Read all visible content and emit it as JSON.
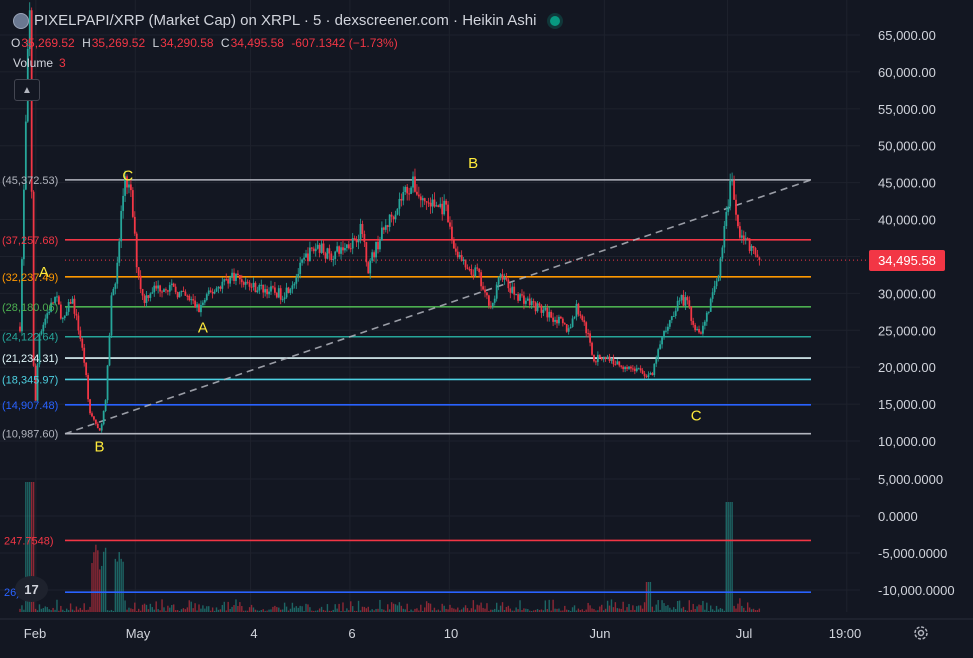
{
  "header": {
    "title": "PIXELPAPI/XRP (Market Cap) on XRPL · 5 · dexscreener.com · Heikin Ashi",
    "ohlc": [
      {
        "k": "O",
        "v": "35,269.52"
      },
      {
        "k": "H",
        "v": "35,269.52"
      },
      {
        "k": "L",
        "v": "34,290.58"
      },
      {
        "k": "C",
        "v": "34,495.58"
      }
    ],
    "change": "-607.1342 (−1.73%)",
    "volume_label": "Volume",
    "volume_value": "3"
  },
  "colors": {
    "bg": "#131722",
    "up": "#26a69a",
    "down": "#f23645",
    "grid": "#1e222d",
    "text": "#d1d4dc",
    "annotation": "#ffeb3b"
  },
  "current_price_label": "34,495.58",
  "icons": {
    "collapse": "chevron-up-icon",
    "logo": "tradingview-logo-icon",
    "settings": "gear-icon",
    "live": "live-status-dot-icon"
  },
  "chart_data": {
    "type": "candlestick",
    "price_axis": {
      "ticks": [
        65000,
        60000,
        55000,
        50000,
        45000,
        40000,
        35000,
        30000,
        25000,
        20000,
        15000,
        10000
      ],
      "tick_labels": [
        "65,000.00",
        "60,000.00",
        "55,000.00",
        "50,000.00",
        "45,000.00",
        "40,000.00",
        "35,000.00",
        "30,000.00",
        "25,000.00",
        "20,000.00",
        "15,000.00",
        "10,000.00"
      ],
      "range": [
        8000,
        67000
      ]
    },
    "indicator_axis": {
      "ticks": [
        5000,
        0,
        -5000,
        -10000
      ],
      "tick_labels": [
        "5,000.0000",
        "0.0000",
        "-5,000.0000",
        "-10,000.0000"
      ],
      "range": [
        -12000,
        6500
      ]
    },
    "time_axis": {
      "labels": [
        "Feb",
        "May",
        "4",
        "6",
        "10",
        "Jun",
        "Jul",
        "19:00"
      ]
    },
    "levels": [
      {
        "value": 45372.53,
        "label": "45,372.53",
        "color": "#b2b5be"
      },
      {
        "value": 37257.68,
        "label": "37,257.68",
        "color": "#f23645"
      },
      {
        "value": 32237.49,
        "label": "32,237.49",
        "color": "#ff9800"
      },
      {
        "value": 28180.06,
        "label": "28,180.06",
        "color": "#4caf50"
      },
      {
        "value": 24122.64,
        "label": "24,122.64",
        "color": "#26a69a"
      },
      {
        "value": 21234.31,
        "label": "21,234.31",
        "color": "#e0f7fa"
      },
      {
        "value": 18345.97,
        "label": "18,345.97",
        "color": "#4dd0e1"
      },
      {
        "value": 14907.48,
        "label": "14,907.48",
        "color": "#2962ff"
      },
      {
        "value": 10987.6,
        "label": "10,987.60",
        "color": "#b2b5be"
      }
    ],
    "indicator_levels": [
      {
        "value": -3300,
        "label": "247.7548",
        "color": "#f23645"
      },
      {
        "value": -10300,
        "label": "26",
        "color": "#2962ff"
      }
    ],
    "trendline": {
      "from": 10987.6,
      "to": 45372.53,
      "style": "dashed"
    },
    "wave_labels": [
      {
        "text": "A",
        "t": 0.03,
        "price": 33000
      },
      {
        "text": "B",
        "t": 0.1,
        "price": 9400
      },
      {
        "text": "C",
        "t": 0.135,
        "price": 46100
      },
      {
        "text": "A",
        "t": 0.23,
        "price": 25500
      },
      {
        "text": "B",
        "t": 0.57,
        "price": 47800
      },
      {
        "text": "C",
        "t": 0.85,
        "price": 13600
      }
    ],
    "current_price": 34495.58,
    "keypoints": [
      [
        0.0,
        25500
      ],
      [
        0.012,
        70000
      ],
      [
        0.018,
        12000
      ],
      [
        0.024,
        24500
      ],
      [
        0.035,
        27500
      ],
      [
        0.045,
        29500
      ],
      [
        0.055,
        26000
      ],
      [
        0.065,
        29500
      ],
      [
        0.075,
        24500
      ],
      [
        0.082,
        20000
      ],
      [
        0.087,
        14000
      ],
      [
        0.095,
        12500
      ],
      [
        0.1,
        11000
      ],
      [
        0.108,
        15500
      ],
      [
        0.115,
        29500
      ],
      [
        0.122,
        33000
      ],
      [
        0.128,
        42000
      ],
      [
        0.133,
        45600
      ],
      [
        0.14,
        43000
      ],
      [
        0.147,
        34000
      ],
      [
        0.155,
        29000
      ],
      [
        0.165,
        30500
      ],
      [
        0.185,
        31000
      ],
      [
        0.2,
        30000
      ],
      [
        0.215,
        29000
      ],
      [
        0.225,
        27800
      ],
      [
        0.235,
        29500
      ],
      [
        0.255,
        31500
      ],
      [
        0.27,
        32500
      ],
      [
        0.29,
        31000
      ],
      [
        0.31,
        30500
      ],
      [
        0.33,
        29800
      ],
      [
        0.345,
        31800
      ],
      [
        0.36,
        35000
      ],
      [
        0.375,
        36500
      ],
      [
        0.39,
        35000
      ],
      [
        0.405,
        36000
      ],
      [
        0.42,
        37300
      ],
      [
        0.43,
        38800
      ],
      [
        0.438,
        33500
      ],
      [
        0.445,
        35500
      ],
      [
        0.455,
        38000
      ],
      [
        0.47,
        41000
      ],
      [
        0.485,
        44000
      ],
      [
        0.495,
        44800
      ],
      [
        0.505,
        42600
      ],
      [
        0.52,
        42000
      ],
      [
        0.535,
        41500
      ],
      [
        0.545,
        36500
      ],
      [
        0.555,
        34500
      ],
      [
        0.565,
        32500
      ],
      [
        0.575,
        33000
      ],
      [
        0.585,
        29500
      ],
      [
        0.595,
        28500
      ],
      [
        0.605,
        33000
      ],
      [
        0.615,
        30500
      ],
      [
        0.63,
        29500
      ],
      [
        0.645,
        28500
      ],
      [
        0.66,
        27500
      ],
      [
        0.675,
        26500
      ],
      [
        0.69,
        25000
      ],
      [
        0.7,
        28000
      ],
      [
        0.708,
        26500
      ],
      [
        0.715,
        24000
      ],
      [
        0.722,
        21000
      ],
      [
        0.735,
        21500
      ],
      [
        0.75,
        20500
      ],
      [
        0.765,
        20000
      ],
      [
        0.78,
        19500
      ],
      [
        0.79,
        18800
      ],
      [
        0.795,
        18800
      ],
      [
        0.802,
        22000
      ],
      [
        0.81,
        24500
      ],
      [
        0.82,
        27000
      ],
      [
        0.83,
        29500
      ],
      [
        0.84,
        28500
      ],
      [
        0.848,
        25500
      ],
      [
        0.858,
        25000
      ],
      [
        0.866,
        28000
      ],
      [
        0.873,
        30000
      ],
      [
        0.88,
        34000
      ],
      [
        0.888,
        40000
      ],
      [
        0.895,
        46000
      ],
      [
        0.902,
        39000
      ],
      [
        0.91,
        37500
      ],
      [
        0.92,
        36000
      ],
      [
        0.93,
        34500
      ]
    ]
  }
}
